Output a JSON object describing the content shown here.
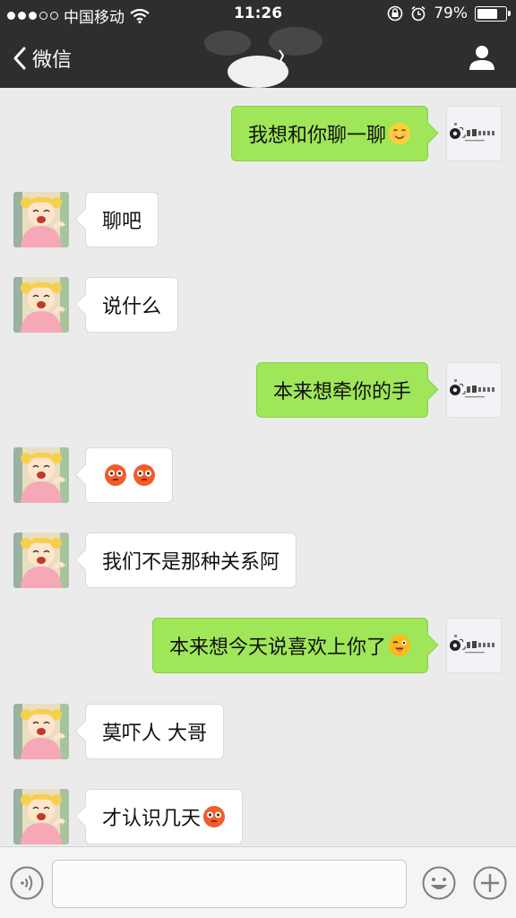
{
  "status_bar": {
    "carrier": "中国移动",
    "time": "11:26",
    "battery": "79%",
    "battery_level": 0.79,
    "icons": [
      "signal-dots",
      "wifi-icon",
      "orientation-lock-icon",
      "alarm-icon",
      "battery-icon"
    ]
  },
  "nav": {
    "back_label": "微信",
    "icons": [
      "chevron-left-icon",
      "profile-icon"
    ]
  },
  "messages": [
    {
      "side": "right",
      "text": "我想和你聊一聊",
      "emoji": "smile"
    },
    {
      "side": "left",
      "text": "聊吧"
    },
    {
      "side": "left",
      "text": "说什么"
    },
    {
      "side": "right",
      "text": "本来想牵你的手"
    },
    {
      "side": "left",
      "text": "",
      "emoji": "flushed-two"
    },
    {
      "side": "left",
      "text": "我们不是那种关系阿"
    },
    {
      "side": "right",
      "text": "本来想今天说喜欢上你了",
      "emoji": "wink"
    },
    {
      "side": "left",
      "text": "莫吓人 大哥"
    },
    {
      "side": "left",
      "text": "才认识几天",
      "emoji": "flushed"
    }
  ],
  "input_bar": {
    "value": "",
    "icons": [
      "voice-icon",
      "emoji-icon",
      "plus-icon"
    ]
  },
  "colors": {
    "nav_bg": "#2e2e2f",
    "chat_bg": "#ebebeb",
    "sent_bubble": "#9fe658",
    "received_bubble": "#ffffff"
  }
}
